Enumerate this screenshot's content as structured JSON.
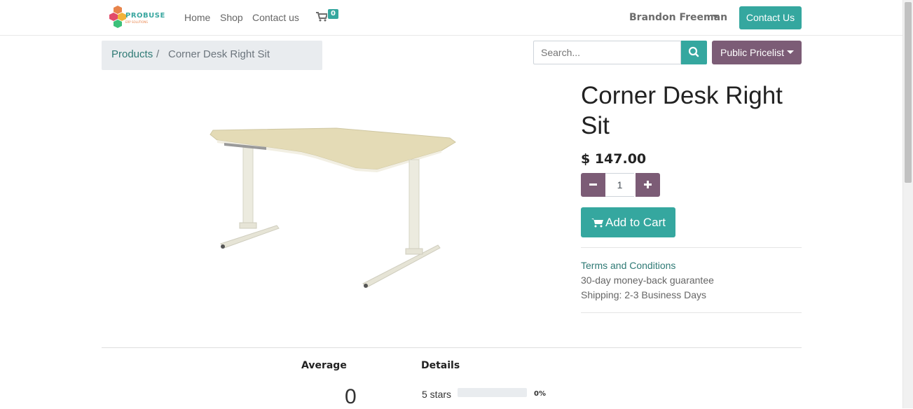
{
  "nav": {
    "logo_text": "PROBUSE",
    "logo_subtext": "ERP SOLUTIONS",
    "links": [
      "Home",
      "Shop",
      "Contact us"
    ],
    "cart_count": "0",
    "user_name": "Brandon Freeman",
    "contact_button": "Contact Us"
  },
  "breadcrumb": {
    "parent": "Products",
    "separator": "/",
    "current": "Corner Desk Right Sit"
  },
  "search": {
    "placeholder": "Search..."
  },
  "pricelist": {
    "label": "Public Pricelist"
  },
  "product": {
    "name": "Corner Desk Right Sit",
    "price": "$ 147.00",
    "quantity": "1",
    "add_to_cart": "Add to Cart",
    "terms": "Terms and Conditions",
    "guarantee": "30-day money-back guarantee",
    "shipping": "Shipping: 2-3 Business Days"
  },
  "ratings": {
    "average_label": "Average",
    "details_label": "Details",
    "average_value": "0",
    "rows": [
      {
        "label": "5 stars",
        "percent_text": "0%",
        "fill_fraction": 0
      }
    ]
  },
  "colors": {
    "primary": "#35a79f",
    "secondary": "#7c5c76",
    "link": "#2f7a75"
  }
}
